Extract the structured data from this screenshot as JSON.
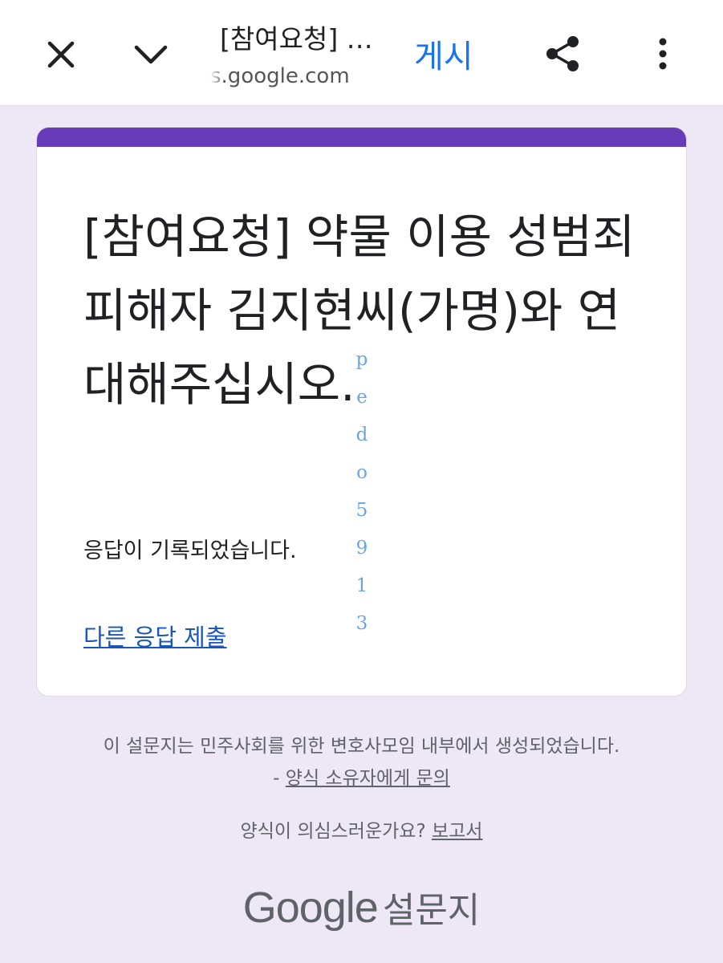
{
  "browser_bar": {
    "title": "[참여요청] …",
    "url": "s.google.com",
    "action_label": "게시",
    "icons": {
      "close": "close-icon",
      "collapse": "chevron-down-icon",
      "share": "share-icon",
      "more": "more-vert-icon"
    }
  },
  "form": {
    "accent_color": "#673ab7",
    "title": "[참여요청] 약물 이용 성범죄 피해자 김지현씨(가명)와 연대해주십시오.",
    "confirmation": "응답이 기록되었습니다.",
    "another_response_link": "다른 응답 제출"
  },
  "watermark": "p e d o 5 9 1 3",
  "footer": {
    "created_by": "이 설문지는 민주사회를 위한 변호사모임 내부에서 생성되었습니다.",
    "contact_prefix": "- ",
    "contact_link": "양식 소유자에게 문의",
    "suspicious_question": "양식이 의심스러운가요? ",
    "report_link": "보고서",
    "brand_google": "Google",
    "brand_forms": "설문지"
  }
}
